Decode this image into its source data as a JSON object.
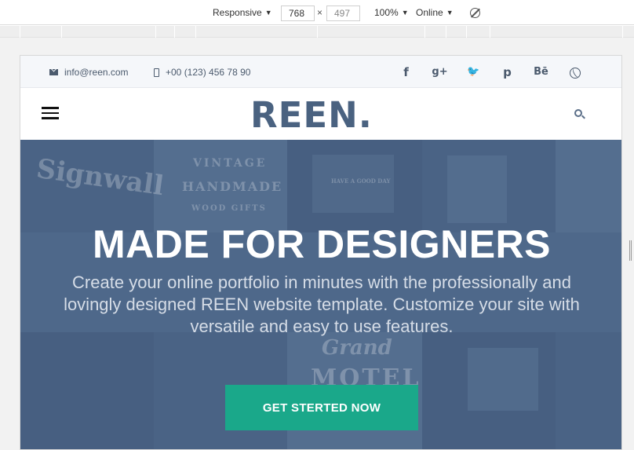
{
  "devtools": {
    "device": "Responsive",
    "width": "768",
    "height": "497",
    "times": "×",
    "zoom": "100%",
    "network": "Online"
  },
  "site": {
    "topbar": {
      "email": "info@reen.com",
      "phone": "+00 (123) 456 78 90",
      "socials": [
        {
          "name": "facebook-icon",
          "glyph": "f"
        },
        {
          "name": "google-plus-icon",
          "glyph": "g+"
        },
        {
          "name": "twitter-icon",
          "glyph": "🐦"
        },
        {
          "name": "pinterest-icon",
          "glyph": "p"
        },
        {
          "name": "behance-icon",
          "glyph": "Bē"
        },
        {
          "name": "dribbble-icon",
          "glyph": ""
        }
      ]
    },
    "logo": "REEN.",
    "hero": {
      "title": "MADE FOR DESIGNERS",
      "subtitle": "Create your online portfolio in minutes with the professionally and lovingly designed REEN website template. Customize your site with versatile and easy to use features.",
      "cta": "GET STERTED NOW",
      "watermarks": [
        "Signwall",
        "VINTAGE",
        "HANDMADE",
        "WOOD GIFTS",
        "HAVE A GOOD DAY",
        "Grand",
        "MOTEL"
      ]
    },
    "colors": {
      "logo": "#4a6280",
      "hero_overlay": "#4c688a",
      "cta": "#1aa88a"
    }
  }
}
